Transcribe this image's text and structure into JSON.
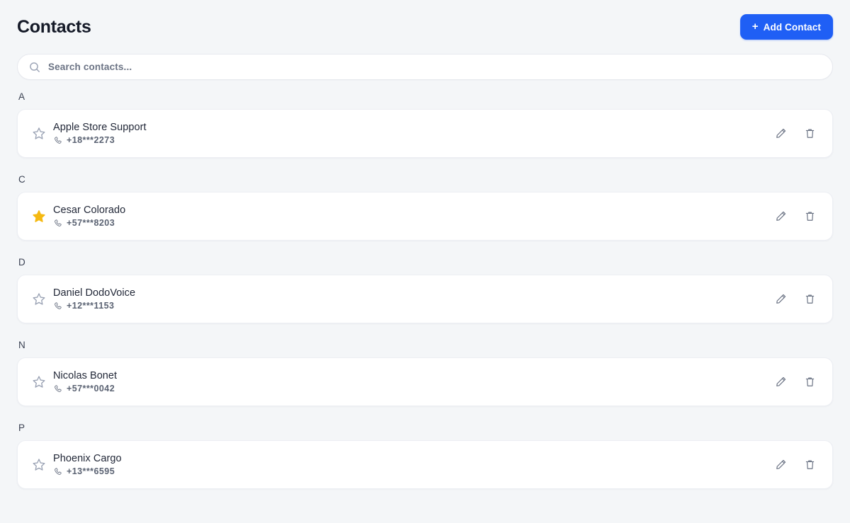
{
  "header": {
    "title": "Contacts",
    "add_button_label": "Add Contact",
    "add_button_plus": "+",
    "add_button_color": "#1f5ff5"
  },
  "search": {
    "placeholder": "Search contacts...",
    "value": "",
    "icon": "search-icon"
  },
  "colors": {
    "background": "#f4f6f8",
    "card": "#ffffff",
    "accent": "#1f5ff5",
    "star_filled": "#f5b912",
    "star_outline": "#9aa2b4",
    "icon_gray": "#6b7384"
  },
  "sections": [
    {
      "letter": "A",
      "contacts": [
        {
          "name": "Apple Store Support",
          "phone": "+18***2273",
          "starred": false,
          "edit_label": "edit-icon",
          "delete_label": "trash-icon"
        }
      ]
    },
    {
      "letter": "C",
      "contacts": [
        {
          "name": "Cesar Colorado",
          "phone": "+57***8203",
          "starred": true,
          "edit_label": "edit-icon",
          "delete_label": "trash-icon"
        }
      ]
    },
    {
      "letter": "D",
      "contacts": [
        {
          "name": "Daniel DodoVoice",
          "phone": "+12***1153",
          "starred": false,
          "edit_label": "edit-icon",
          "delete_label": "trash-icon"
        }
      ]
    },
    {
      "letter": "N",
      "contacts": [
        {
          "name": "Nicolas Bonet",
          "phone": "+57***0042",
          "starred": false,
          "edit_label": "edit-icon",
          "delete_label": "trash-icon"
        }
      ]
    },
    {
      "letter": "P",
      "contacts": [
        {
          "name": "Phoenix Cargo",
          "phone": "+13***6595",
          "starred": false,
          "edit_label": "edit-icon",
          "delete_label": "trash-icon"
        }
      ]
    }
  ]
}
